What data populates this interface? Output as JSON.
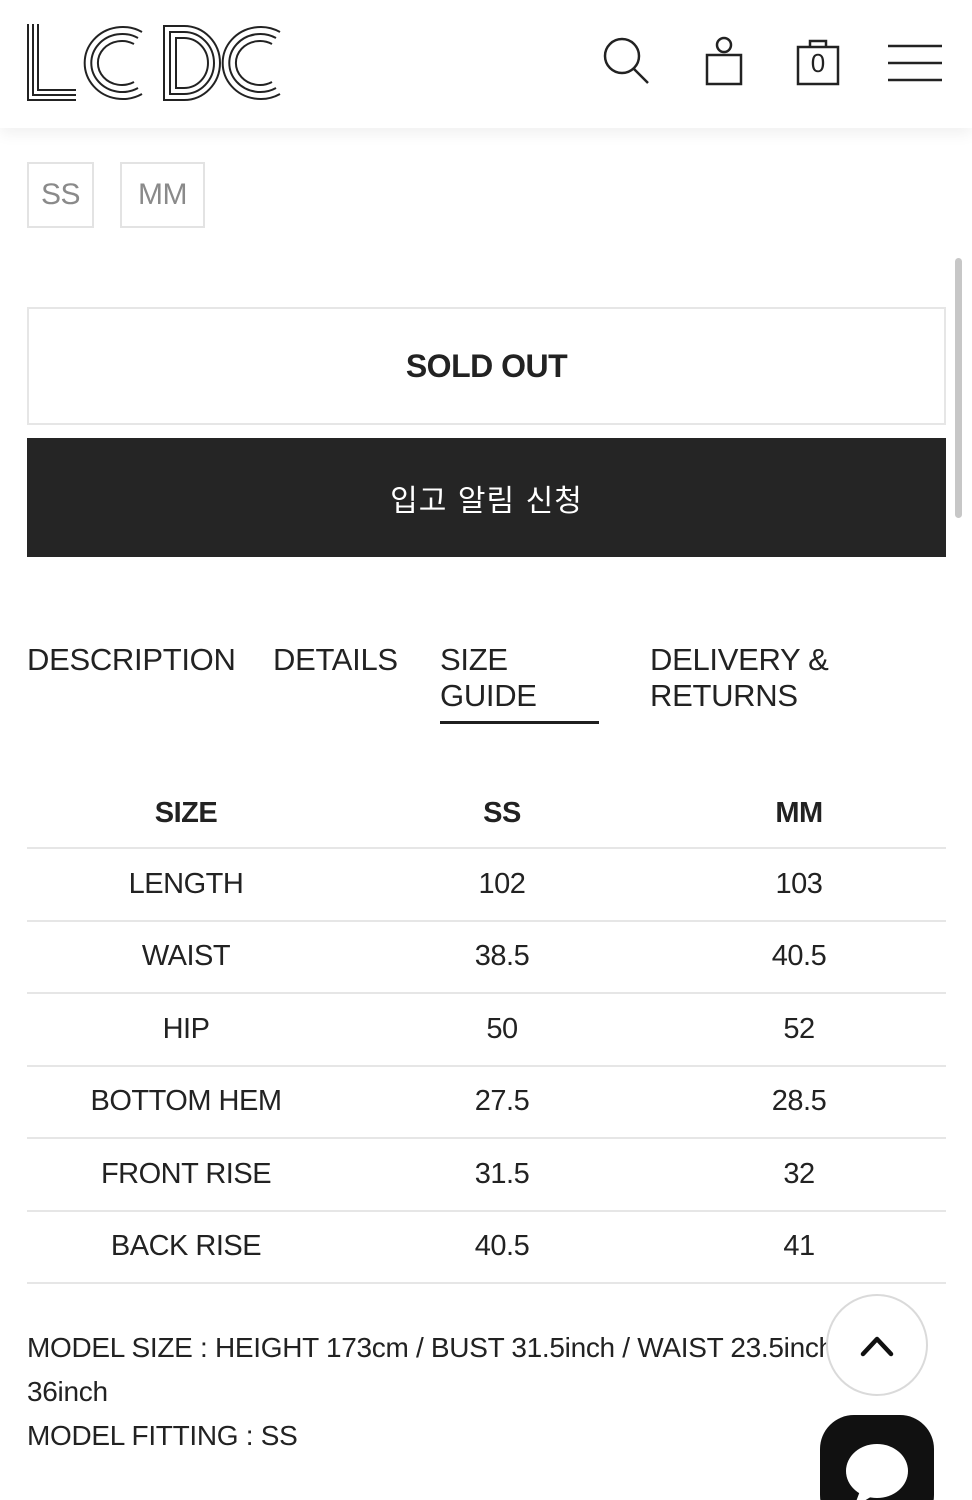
{
  "header": {
    "logo_text": "LCDC",
    "cart_count": "0",
    "icons": [
      "search-icon",
      "account-icon",
      "cart-icon",
      "menu-icon"
    ]
  },
  "size_options": [
    "SS",
    "MM"
  ],
  "buttons": {
    "sold_out": "SOLD OUT",
    "notify": "입고 알림 신청"
  },
  "tabs": {
    "description": "DESCRIPTION",
    "details": "DETAILS",
    "size_guide_line1": "SIZE",
    "size_guide_line2": "GUIDE",
    "delivery_line1": "DELIVERY &",
    "delivery_line2": "RETURNS",
    "active": "SIZE GUIDE"
  },
  "size_table": {
    "headers": [
      "SIZE",
      "SS",
      "MM"
    ],
    "rows": [
      [
        "LENGTH",
        "102",
        "103"
      ],
      [
        "WAIST",
        "38.5",
        "40.5"
      ],
      [
        "HIP",
        "50",
        "52"
      ],
      [
        "BOTTOM HEM",
        "27.5",
        "28.5"
      ],
      [
        "FRONT RISE",
        "31.5",
        "32"
      ],
      [
        "BACK RISE",
        "40.5",
        "41"
      ]
    ]
  },
  "model_info": {
    "line1": "MODEL SIZE : HEIGHT 173cm / BUST 31.5inch / WAIST 23.5inch",
    "line2": "36inch",
    "line3": "MODEL FITTING : SS"
  },
  "colors": {
    "dark_button": "#252525",
    "border": "#e6e6e6",
    "text": "#222222"
  }
}
